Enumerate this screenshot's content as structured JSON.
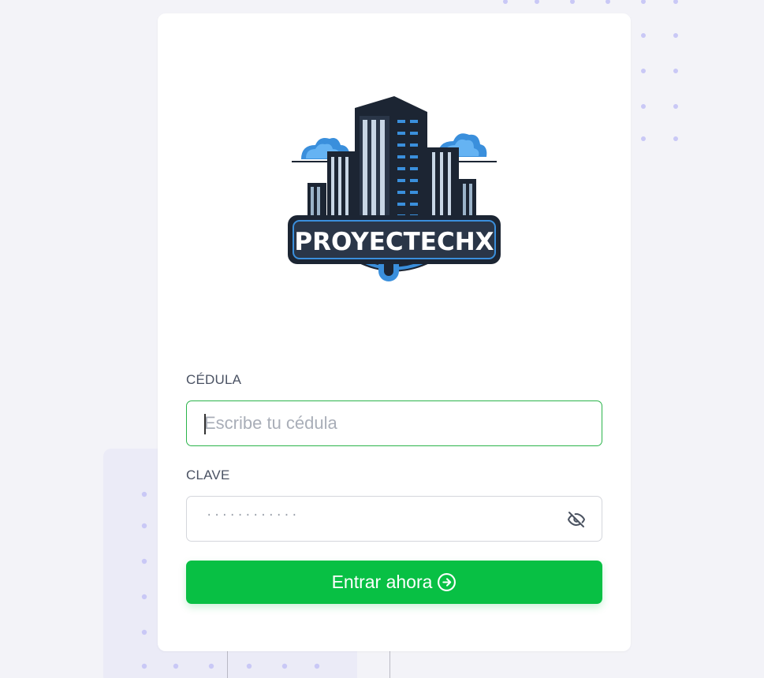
{
  "brand": {
    "logo_text": "PROYECTECHX"
  },
  "form": {
    "cedula": {
      "label": "CÉDULA",
      "placeholder": "Escribe tu cédula",
      "value": ""
    },
    "clave": {
      "label": "CLAVE",
      "masked_value": "············"
    },
    "submit_label": "Entrar ahora"
  },
  "icons": {
    "password_toggle": "eye-off-icon",
    "submit": "arrow-right-circle-icon"
  },
  "colors": {
    "primary": "#08c044",
    "focus_border": "#2bb44b",
    "background": "#f3f3f8",
    "decor_dots": "#c9c8f6",
    "logo_blue": "#3a8fdc",
    "logo_dark": "#1c2533"
  }
}
